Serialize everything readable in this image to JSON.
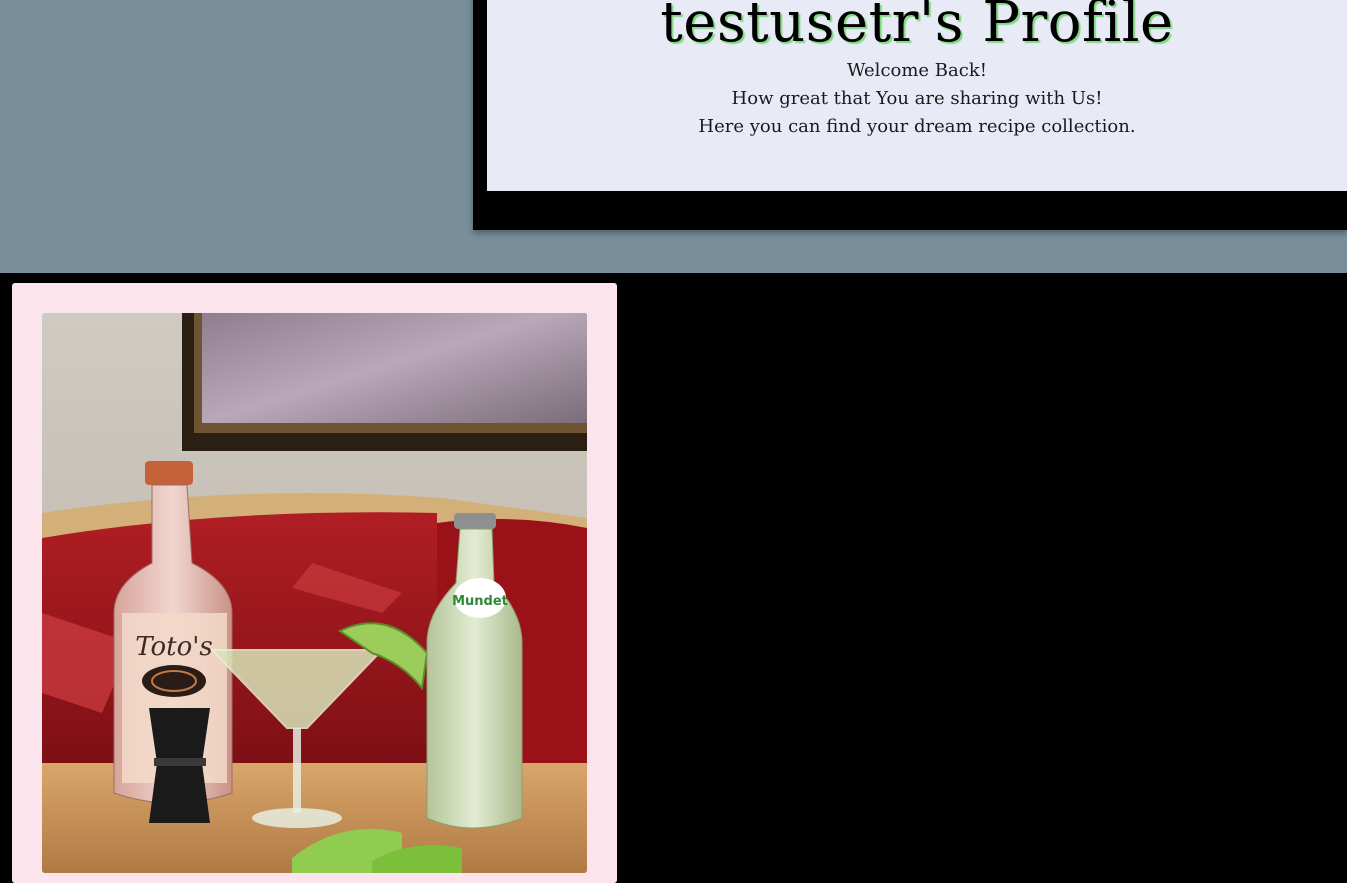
{
  "profile": {
    "title": "testusetr's Profile",
    "welcome_lines": [
      "Welcome Back!",
      "How great that You are sharing with Us!",
      "Here you can find your dream recipe collection."
    ]
  },
  "recipe_photo": {
    "icon": "cocktail-photo",
    "bottle_left_label": "Toto's",
    "bottle_right_label": "Mundet"
  },
  "colors": {
    "top_band": "#788f9b",
    "profile_card": "#e8eaf6",
    "recipe_card": "#fce4ec",
    "page_background": "#000000",
    "title_shadow": "#7fd97f"
  }
}
